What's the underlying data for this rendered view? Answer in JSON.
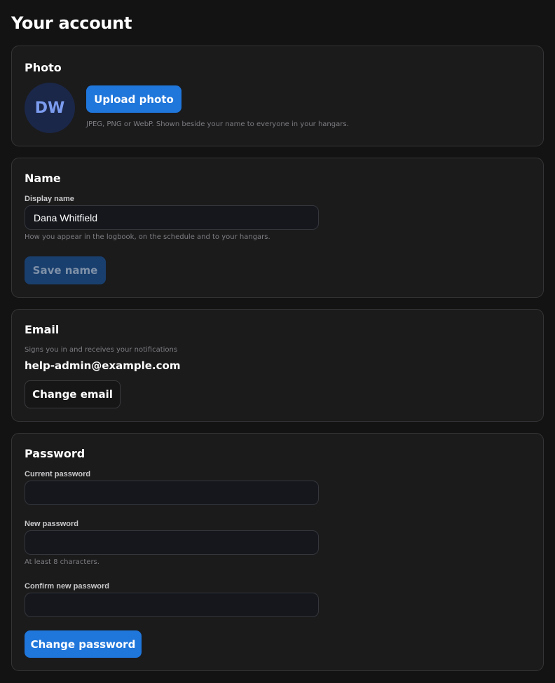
{
  "page": {
    "title": "Your account"
  },
  "photo": {
    "title": "Photo",
    "initials": "DW",
    "upload_label": "Upload photo",
    "hint": "JPEG, PNG or WebP. Shown beside your name to everyone in your hangars."
  },
  "name": {
    "title": "Name",
    "field_label": "Display name",
    "value": "Dana Whitfield",
    "hint": "How you appear in the logbook, on the schedule and to your hangars.",
    "save_label": "Save name"
  },
  "email": {
    "title": "Email",
    "hint": "Signs you in and receives your notifications",
    "value": "help-admin@example.com",
    "change_label": "Change email"
  },
  "password": {
    "title": "Password",
    "current_label": "Current password",
    "current_value": "",
    "new_label": "New password",
    "new_value": "",
    "new_hint": "At least 8 characters.",
    "confirm_label": "Confirm new password",
    "confirm_value": "",
    "submit_label": "Change password"
  }
}
